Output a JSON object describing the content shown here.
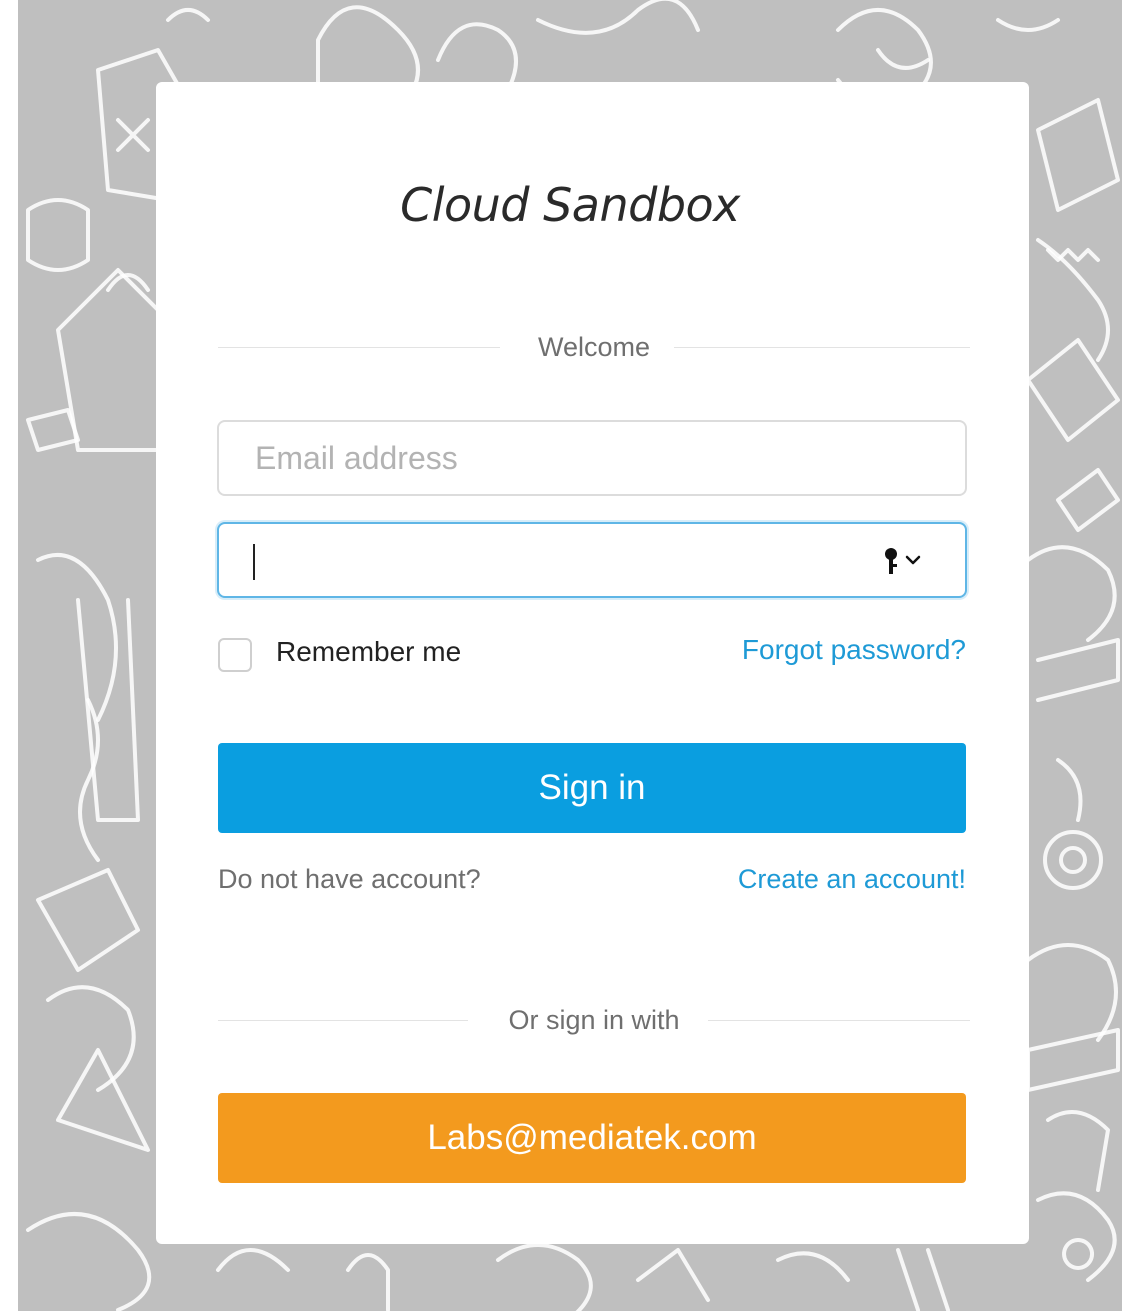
{
  "brand": {
    "title": "Cloud Sandbox"
  },
  "login": {
    "welcome_label": "Welcome",
    "email_placeholder": "Email address",
    "password_value": "",
    "remember_label": "Remember me",
    "remember_checked": false,
    "forgot_label": "Forgot password?",
    "signin_label": "Sign in",
    "no_account_text": "Do not have account?",
    "create_account_label": "Create an account!",
    "alt_signin_label": "Or sign in with",
    "sso_label": "Labs@mediatek.com"
  },
  "icons": {
    "password_manager": "key-icon",
    "dropdown": "chevron-down-icon"
  },
  "colors": {
    "primary": "#0a9ee0",
    "sso": "#f39a1e",
    "link": "#1e9ad6",
    "focus": "#5fb6e6",
    "background": "#bfbfbf"
  }
}
